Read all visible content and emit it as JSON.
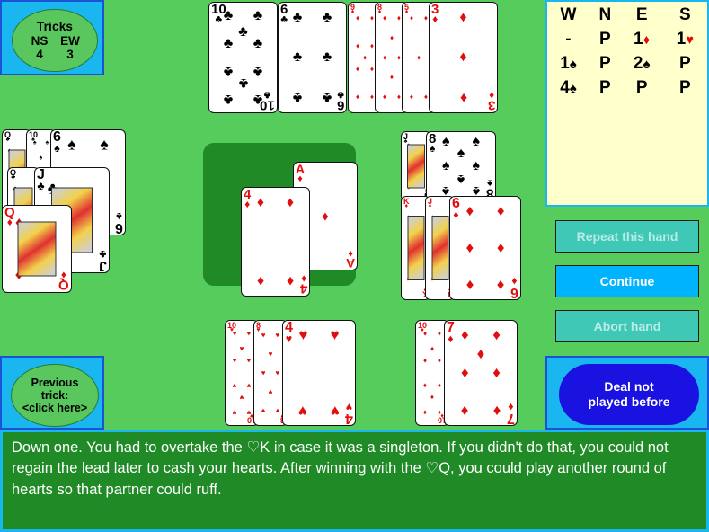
{
  "tricks": {
    "title": "Tricks",
    "side1": "NS",
    "side2": "EW",
    "value1": "4",
    "value2": "3"
  },
  "previous_trick": {
    "line1": "Previous",
    "line2": "trick:",
    "line3": "<click here>"
  },
  "bidding": {
    "headers": [
      "W",
      "N",
      "E",
      "S"
    ],
    "rows": [
      [
        {
          "level": "-",
          "suit": "",
          "color": "black"
        },
        {
          "level": "P",
          "suit": "",
          "color": "black"
        },
        {
          "level": "1",
          "suit": "♦",
          "color": "red"
        },
        {
          "level": "1",
          "suit": "♥",
          "color": "red"
        }
      ],
      [
        {
          "level": "1",
          "suit": "♠",
          "color": "black"
        },
        {
          "level": "P",
          "suit": "",
          "color": "black"
        },
        {
          "level": "2",
          "suit": "♠",
          "color": "black"
        },
        {
          "level": "P",
          "suit": "",
          "color": "black"
        }
      ],
      [
        {
          "level": "4",
          "suit": "♠",
          "color": "black"
        },
        {
          "level": "P",
          "suit": "",
          "color": "black"
        },
        {
          "level": "P",
          "suit": "",
          "color": "black"
        },
        {
          "level": "P",
          "suit": "",
          "color": "black"
        }
      ]
    ]
  },
  "buttons": {
    "repeat": "Repeat this hand",
    "continue": "Continue",
    "abort": "Abort hand"
  },
  "deal_status": {
    "line1": "Deal not",
    "line2": "played before"
  },
  "hands": {
    "north": [
      {
        "rank": "10",
        "suit": "♣",
        "color": "black"
      },
      {
        "rank": "6",
        "suit": "♣",
        "color": "black"
      }
    ],
    "north_east": [
      {
        "rank": "9",
        "suit": "♦",
        "color": "red"
      },
      {
        "rank": "8",
        "suit": "♦",
        "color": "red"
      },
      {
        "rank": "5",
        "suit": "♦",
        "color": "red"
      },
      {
        "rank": "3",
        "suit": "♦",
        "color": "red"
      }
    ],
    "west_top": [
      {
        "rank": "Q",
        "suit": "♠",
        "color": "black"
      },
      {
        "rank": "10",
        "suit": "♠",
        "color": "black"
      },
      {
        "rank": "6",
        "suit": "♠",
        "color": "black"
      }
    ],
    "west_mid": [
      {
        "rank": "Q",
        "suit": "♣",
        "color": "black"
      },
      {
        "rank": "J",
        "suit": "♣",
        "color": "black"
      }
    ],
    "west_front": [
      {
        "rank": "Q",
        "suit": "♦",
        "color": "red"
      }
    ],
    "east_top": [
      {
        "rank": "J",
        "suit": "♠",
        "color": "black"
      },
      {
        "rank": "8",
        "suit": "♠",
        "color": "black"
      }
    ],
    "east_mid": [
      {
        "rank": "K",
        "suit": "♦",
        "color": "red"
      },
      {
        "rank": "J",
        "suit": "♦",
        "color": "red"
      },
      {
        "rank": "6",
        "suit": "♦",
        "color": "red"
      }
    ],
    "south": [
      {
        "rank": "10",
        "suit": "♥",
        "color": "red"
      },
      {
        "rank": "8",
        "suit": "♥",
        "color": "red"
      },
      {
        "rank": "4",
        "suit": "♥",
        "color": "red"
      }
    ],
    "south_east": [
      {
        "rank": "10",
        "suit": "♦",
        "color": "red"
      },
      {
        "rank": "7",
        "suit": "♦",
        "color": "red"
      }
    ]
  },
  "trick": [
    {
      "rank": "A",
      "suit": "♦",
      "color": "red"
    },
    {
      "rank": "4",
      "suit": "♦",
      "color": "red"
    }
  ],
  "commentary": "Down one. You had to overtake the ♡K in case it was a singleton. If you didn't do that, you could not regain the lead later to cash your hearts. After winning with the ♡Q, you could play another round of hearts so that partner could ruff.",
  "colors": {
    "table_green": "#55cc5c",
    "panel_cyan": "#19b6f0",
    "bid_yellow": "#ffffcc",
    "dark_green": "#1f8a26",
    "red_suit": "#e20e0e",
    "active_button": "#00b3ff",
    "disabled_button": "#3fc8b6",
    "deal_blue": "#1a12e0"
  }
}
